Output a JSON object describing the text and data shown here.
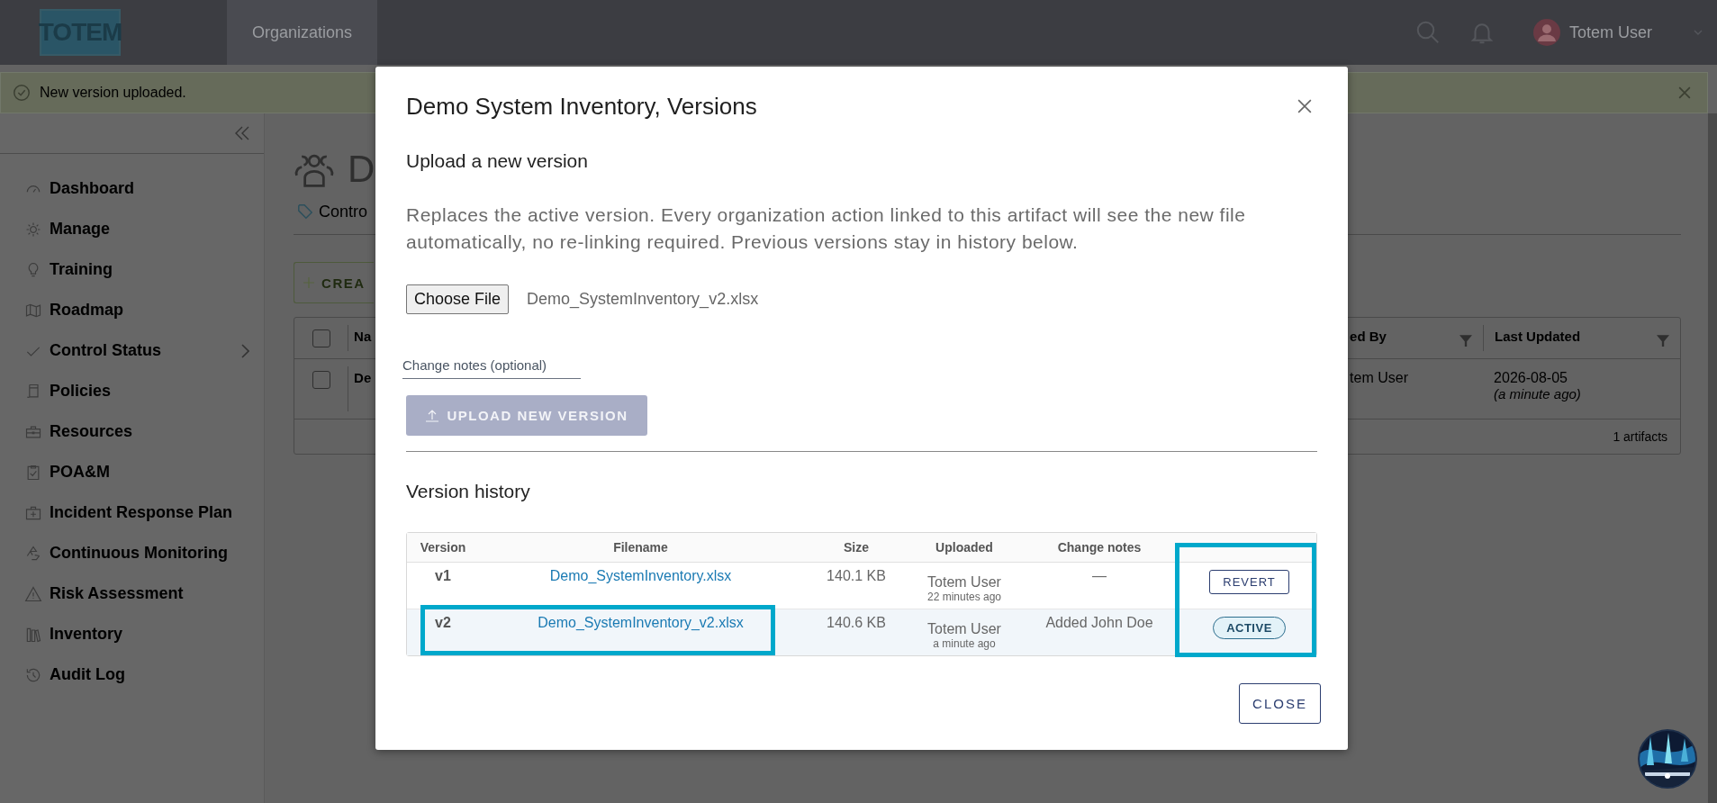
{
  "header": {
    "logo": "TOTEM",
    "nav": [
      {
        "label": "Organizations",
        "selected": true
      }
    ],
    "user": "Totem User"
  },
  "alert": {
    "message": "New version uploaded."
  },
  "sidebar": {
    "items": [
      {
        "label": "Dashboard",
        "expandable": false
      },
      {
        "label": "Manage",
        "expandable": false
      },
      {
        "label": "Training",
        "expandable": false
      },
      {
        "label": "Roadmap",
        "expandable": false
      },
      {
        "label": "Control Status",
        "expandable": true
      },
      {
        "label": "Policies",
        "expandable": false
      },
      {
        "label": "Resources",
        "expandable": false
      },
      {
        "label": "POA&M",
        "expandable": false
      },
      {
        "label": "Incident Response Plan",
        "expandable": false
      },
      {
        "label": "Continuous Monitoring",
        "expandable": false
      },
      {
        "label": "Risk Assessment",
        "expandable": false
      },
      {
        "label": "Inventory",
        "expandable": false
      },
      {
        "label": "Audit Log",
        "expandable": false
      }
    ]
  },
  "page": {
    "title": "D",
    "tag": "Contro",
    "create_button": "CREA",
    "table": {
      "select_all_checked": false,
      "columns": [
        "Na",
        "ed By",
        "Last Updated"
      ],
      "rows": [
        {
          "name": "De",
          "by": "tem User",
          "updated": "2026-08-05",
          "updated_relative": "(a minute ago)",
          "checked": false
        }
      ],
      "footer": "1 artifacts"
    }
  },
  "modal": {
    "title": "Demo System Inventory, Versions",
    "upload_heading": "Upload a new version",
    "description": "Replaces the active version. Every organization action linked to this artifact will see the new file automatically, no re-linking required. Previous versions stay in history below.",
    "choose_file": "Choose File",
    "file_name": "Demo_SystemInventory_v2.xlsx",
    "notes_field": {
      "placeholder": "Change notes (optional)"
    },
    "upload_button": {
      "label": "UPLOAD NEW VERSION",
      "disabled": true
    },
    "history_heading": "Version history",
    "history": {
      "columns": [
        "Version",
        "Filename",
        "Size",
        "Uploaded",
        "Change notes"
      ],
      "actions_highlighted": true,
      "rows": [
        {
          "version": "v1",
          "filename": "Demo_SystemInventory.xlsx",
          "size": "140.1 KB",
          "uploader": "Totem User",
          "when": "22 minutes ago",
          "notes": "—",
          "active": false,
          "filename_highlighted": false,
          "action": {
            "kind": "button",
            "label": "REVERT"
          }
        },
        {
          "version": "v2",
          "filename": "Demo_SystemInventory_v2.xlsx",
          "size": "140.6 KB",
          "uploader": "Totem User",
          "when": "a minute ago",
          "notes": "Added John Doe",
          "active": true,
          "filename_highlighted": true,
          "action": {
            "kind": "badge",
            "label": "ACTIVE"
          }
        }
      ]
    },
    "close_button": "CLOSE"
  }
}
